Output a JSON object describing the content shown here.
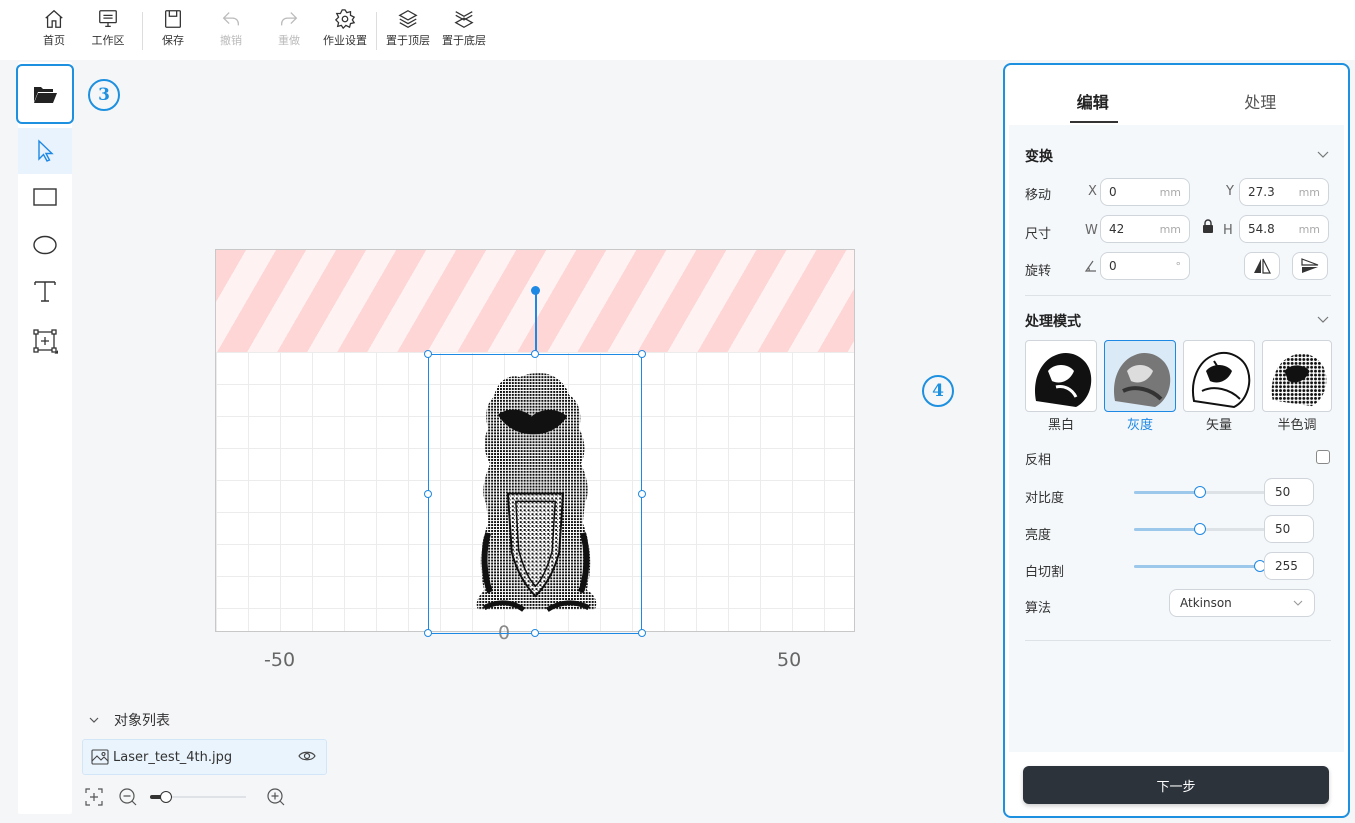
{
  "toolbar": {
    "home": "首页",
    "workspace": "工作区",
    "save": "保存",
    "undo": "撤销",
    "redo": "重做",
    "job_settings": "作业设置",
    "bring_top": "置于顶层",
    "send_bottom": "置于底层"
  },
  "annotations": {
    "step3": "3",
    "step4": "4"
  },
  "canvas": {
    "axis_ticks": [
      "-50",
      "0",
      "50"
    ]
  },
  "object_list": {
    "title": "对象列表",
    "items": [
      {
        "name": "Laser_test_4th.jpg"
      }
    ]
  },
  "zoom": {
    "level": 0.12
  },
  "panel": {
    "tabs": [
      {
        "label": "编辑",
        "active": true
      },
      {
        "label": "处理",
        "active": false
      }
    ],
    "transform": {
      "title": "变换",
      "move_label": "移动",
      "x_tag": "X",
      "x_value": "0",
      "x_unit": "mm",
      "y_tag": "Y",
      "y_value": "27.3",
      "y_unit": "mm",
      "size_label": "尺寸",
      "w_tag": "W",
      "w_value": "42",
      "w_unit": "mm",
      "h_tag": "H",
      "h_value": "54.8",
      "h_unit": "mm",
      "rotate_label": "旋转",
      "angle_value": "0",
      "angle_unit": "°"
    },
    "process_mode": {
      "title": "处理模式",
      "modes": [
        {
          "label": "黑白",
          "active": false
        },
        {
          "label": "灰度",
          "active": true
        },
        {
          "label": "矢量",
          "active": false
        },
        {
          "label": "半色调",
          "active": false
        }
      ],
      "invert_label": "反相",
      "invert_checked": false,
      "contrast_label": "对比度",
      "contrast_value": "50",
      "brightness_label": "亮度",
      "brightness_value": "50",
      "white_cut_label": "白切割",
      "white_cut_value": "255",
      "algorithm_label": "算法",
      "algorithm_value": "Atkinson"
    },
    "next_button": "下一步"
  },
  "colors": {
    "accent": "#1e88e5",
    "dark_button": "#2c333a"
  }
}
